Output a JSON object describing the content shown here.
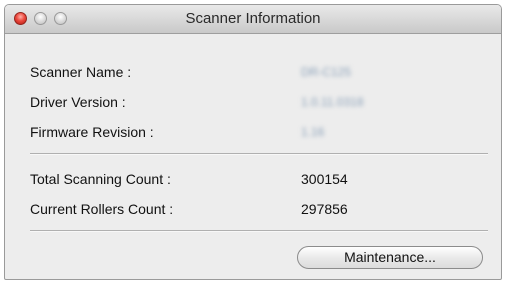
{
  "window": {
    "title": "Scanner Information"
  },
  "fields": {
    "scanner_name_label": "Scanner Name :",
    "scanner_name_value": "DR-C125",
    "driver_version_label": "Driver Version :",
    "driver_version_value": "1.0.11.0318",
    "firmware_revision_label": "Firmware Revision :",
    "firmware_revision_value": "1.16",
    "total_scanning_label": "Total Scanning Count :",
    "total_scanning_value": "300154",
    "current_rollers_label": "Current Rollers Count :",
    "current_rollers_value": "297856"
  },
  "buttons": {
    "maintenance_label": "Maintenance..."
  },
  "colors": {
    "close_light": "#ec4b40",
    "window_bg": "#ededed"
  },
  "icons": {
    "close": "close-icon",
    "minimize": "minimize-icon",
    "zoom": "zoom-icon"
  }
}
